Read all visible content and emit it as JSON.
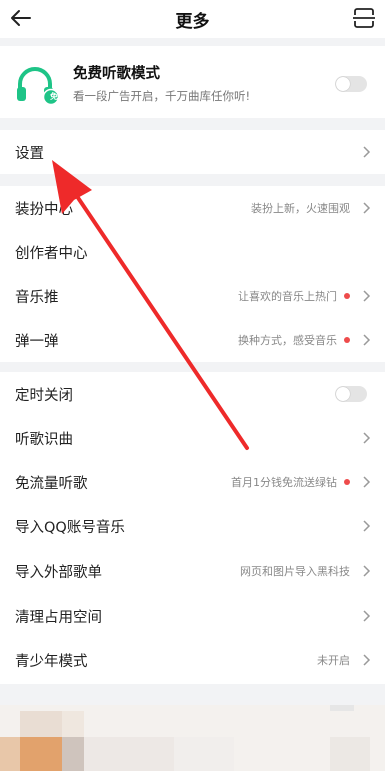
{
  "header": {
    "title": "更多"
  },
  "promo": {
    "title": "免费听歌模式",
    "subtitle": "看一段广告开启，千万曲库任你听!",
    "badge": "免",
    "toggle_on": false
  },
  "group1": [
    {
      "label": "设置"
    }
  ],
  "group2": [
    {
      "label": "装扮中心",
      "hint": "装扮上新，火速围观",
      "dot": false
    },
    {
      "label": "创作者中心",
      "hint": "",
      "dot": false
    },
    {
      "label": "音乐推",
      "hint": "让喜欢的音乐上热门",
      "dot": true
    },
    {
      "label": "弹一弹",
      "hint": "换种方式，感受音乐",
      "dot": true
    }
  ],
  "group3": [
    {
      "label": "定时关闭",
      "toggle_on": false
    },
    {
      "label": "听歌识曲",
      "hint": "",
      "dot": false
    },
    {
      "label": "免流量听歌",
      "hint": "首月1分钱免流送绿钻",
      "dot": true
    },
    {
      "label": "导入QQ账号音乐",
      "hint": "",
      "dot": false
    },
    {
      "label": "导入外部歌单",
      "hint": "网页和图片导入黑科技",
      "dot": false
    },
    {
      "label": "清理占用空间",
      "hint": "",
      "dot": false
    },
    {
      "label": "青少年模式",
      "hint": "未开启",
      "dot": false
    }
  ],
  "colors": {
    "accent_green": "#1ec487",
    "red_dot": "#ee4b4b",
    "annotation_arrow": "#ee2a2a"
  }
}
